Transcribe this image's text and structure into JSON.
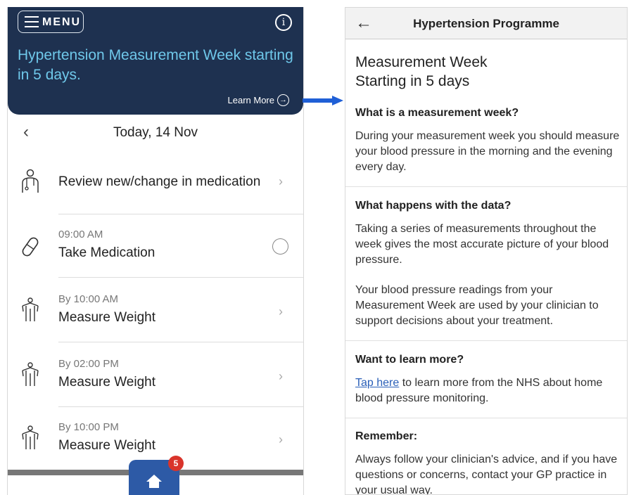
{
  "left": {
    "menu_label": "MENU",
    "banner_title": "Hypertension Measurement Week starting in 5 days.",
    "learn_more": "Learn More",
    "date": "Today, 14 Nov",
    "tasks": [
      {
        "time": "",
        "name": "Review new/change in medication",
        "icon": "doctor-icon"
      },
      {
        "time": "09:00 AM",
        "name": "Take Medication",
        "icon": "pill-icon"
      },
      {
        "time": "By 10:00 AM",
        "name": "Measure Weight",
        "icon": "person-icon"
      },
      {
        "time": "By 02:00 PM",
        "name": "Measure Weight",
        "icon": "person-icon"
      },
      {
        "time": "By 10:00 PM",
        "name": "Measure Weight",
        "icon": "person-icon"
      }
    ],
    "badge_count": "5"
  },
  "right": {
    "header_title": "Hypertension Programme",
    "heading_line1": "Measurement Week",
    "heading_line2": "Starting in 5 days",
    "sections": [
      {
        "title": "What is a measurement week?",
        "text": "During your measurement week you should measure your blood pressure in the morning and the evening every day."
      },
      {
        "title": "What happens with the data?",
        "text": "Taking a series of measurements throughout the week gives the most accurate picture of your blood pressure.",
        "text2": "Your blood pressure readings from your Measurement Week are used by your clinician to support decisions about your treatment."
      },
      {
        "title": "Want to learn more?",
        "link": "Tap here",
        "text": " to learn more from the NHS about home blood pressure monitoring."
      },
      {
        "title": "Remember:",
        "text": "Always follow your clinician's advice, and if you have questions or concerns, contact your GP practice in your usual way."
      }
    ]
  },
  "colors": {
    "banner": "#1e3150",
    "banner_text": "#6fc8ea",
    "accent": "#2d5aa6",
    "arrow": "#1f5fd6",
    "badge": "#d9342b"
  }
}
